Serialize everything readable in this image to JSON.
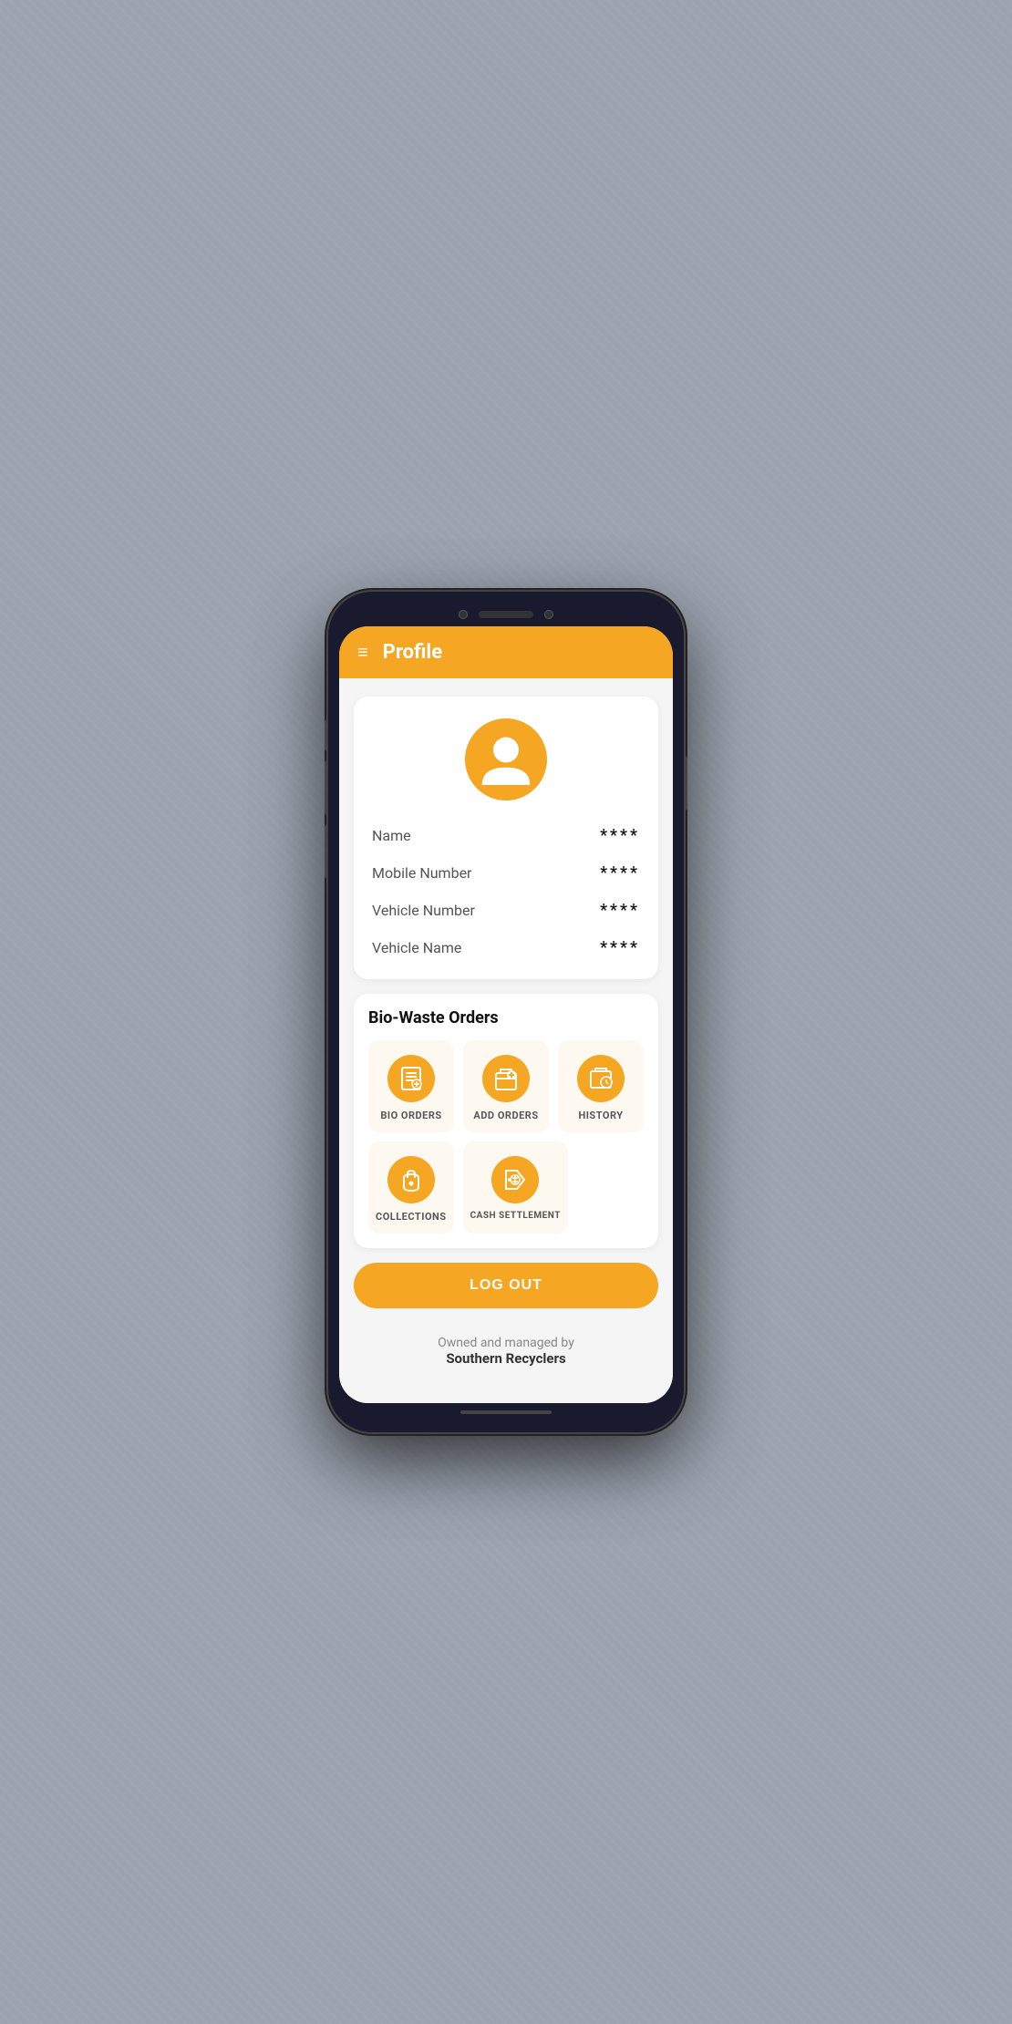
{
  "header": {
    "title": "Profile",
    "menu_icon": "≡"
  },
  "profile": {
    "fields": [
      {
        "label": "Name",
        "value": "****"
      },
      {
        "label": "Mobile Number",
        "value": "****"
      },
      {
        "label": "Vehicle Number",
        "value": "****"
      },
      {
        "label": "Vehicle Name",
        "value": "****"
      }
    ]
  },
  "orders_section": {
    "title": "Bio-Waste Orders",
    "tiles_row1": [
      {
        "id": "bio-orders",
        "label": "BIO ORDERS"
      },
      {
        "id": "add-orders",
        "label": "ADD ORDERS"
      },
      {
        "id": "history",
        "label": "HISTORY"
      }
    ],
    "tiles_row2": [
      {
        "id": "collections",
        "label": "COLLECTIONS"
      },
      {
        "id": "cash-settlement",
        "label": "CASH SETTLEMENT"
      }
    ]
  },
  "logout": {
    "label": "LOG OUT"
  },
  "footer": {
    "line1": "Owned and managed by",
    "line2": "Southern Recyclers"
  },
  "colors": {
    "primary": "#f5a623",
    "tile_bg": "#fef9f0"
  }
}
